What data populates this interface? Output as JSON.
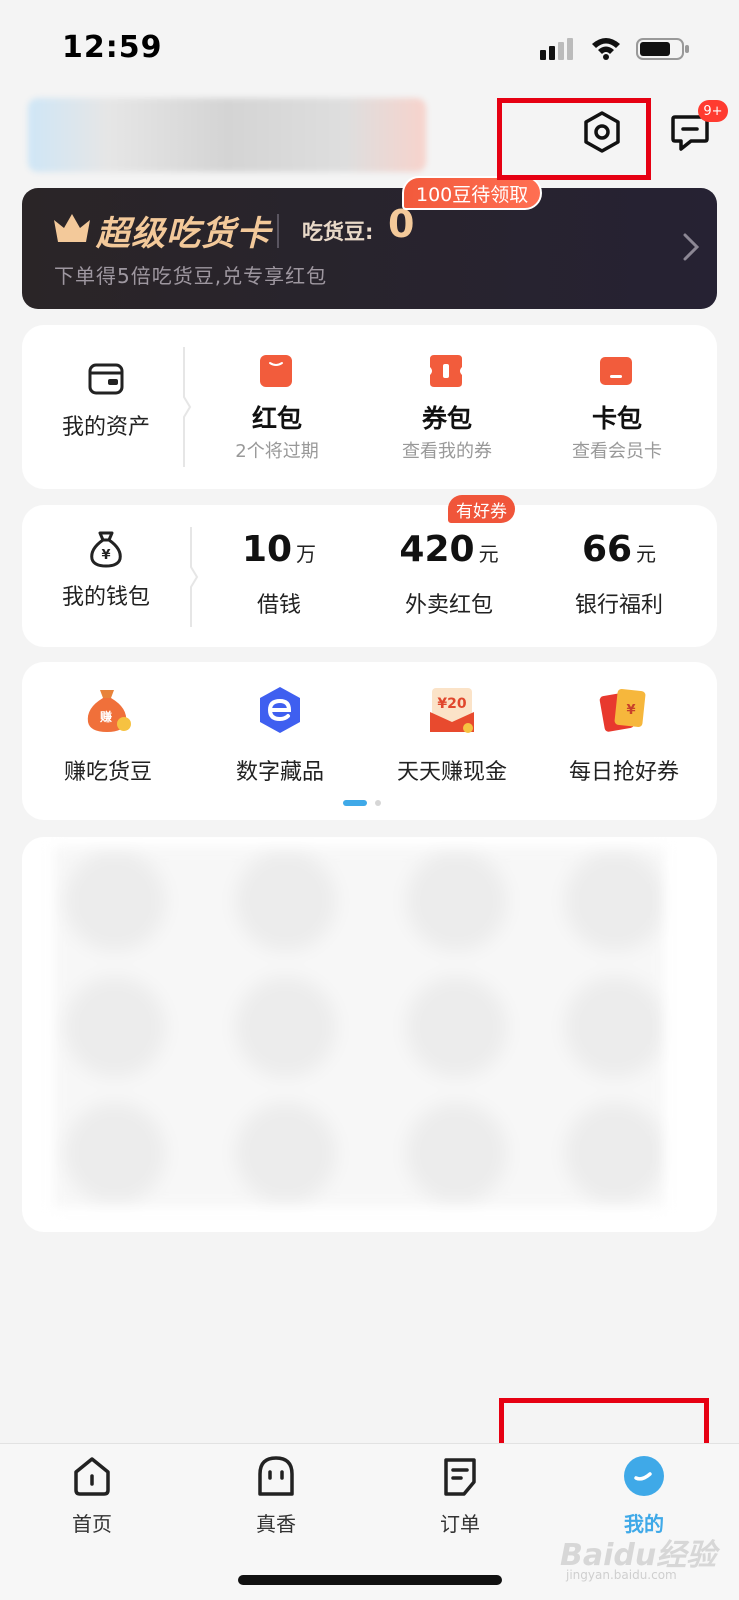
{
  "status_bar": {
    "time": "12:59"
  },
  "header": {
    "message_badge": "9+"
  },
  "super_card": {
    "title": "超级吃货卡",
    "beans_label": "吃货豆:",
    "beans_value": "0",
    "subtitle": "下单得5倍吃货豆,兑专享红包",
    "promo_pill": "100豆待领取"
  },
  "assets": {
    "label": "我的资产",
    "items": [
      {
        "title": "红包",
        "sub": "2个将过期",
        "icon": "red-packet-icon"
      },
      {
        "title": "券包",
        "sub": "查看我的券",
        "icon": "coupon-icon"
      },
      {
        "title": "卡包",
        "sub": "查看会员卡",
        "icon": "card-icon"
      }
    ]
  },
  "wallet": {
    "label": "我的钱包",
    "tag": "有好券",
    "items": [
      {
        "value": "10",
        "unit": "万",
        "label": "借钱"
      },
      {
        "value": "420",
        "unit": "元",
        "label": "外卖红包"
      },
      {
        "value": "66",
        "unit": "元",
        "label": "银行福利"
      }
    ]
  },
  "features": {
    "items": [
      {
        "label": "赚吃货豆",
        "icon": "money-bag-icon"
      },
      {
        "label": "数字藏品",
        "icon": "digital-collectible-icon"
      },
      {
        "label": "天天赚现金",
        "icon": "cash-envelope-icon",
        "badge": "¥20"
      },
      {
        "label": "每日抢好券",
        "icon": "ticket-icon"
      }
    ]
  },
  "tabs": [
    {
      "label": "首页",
      "icon": "home-icon"
    },
    {
      "label": "真香",
      "icon": "ghost-face-icon"
    },
    {
      "label": "订单",
      "icon": "order-icon"
    },
    {
      "label": "我的",
      "icon": "profile-icon",
      "active": true
    }
  ],
  "watermark": {
    "text": "Baidu经验",
    "sub": "jingyan.baidu.com"
  },
  "colors": {
    "accent_blue": "#3fa9e8",
    "promo_red": "#f0553a",
    "gold": "#f3c99a",
    "annotation_red": "#e60012"
  }
}
